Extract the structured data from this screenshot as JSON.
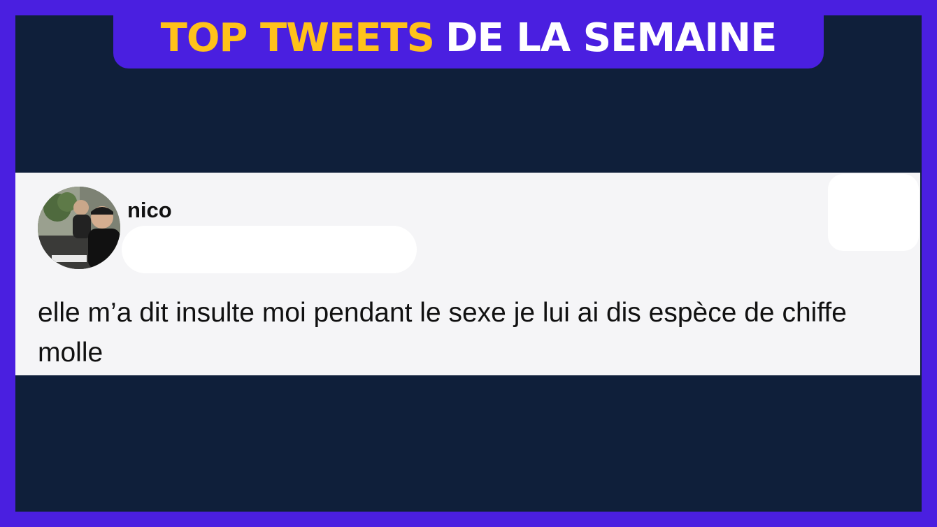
{
  "banner": {
    "title_accent": "TOP TWEETS",
    "title_rest": "DE LA SEMAINE",
    "accent_color": "#ffc21a",
    "frame_color": "#4a1fe0",
    "background_color": "#0f1f3a"
  },
  "tweet": {
    "username": "nico",
    "text": "elle m’a dit insulte moi pendant le sexe je lui ai dis espèce de chiffe molle",
    "avatar_icon": "profile-photo"
  }
}
